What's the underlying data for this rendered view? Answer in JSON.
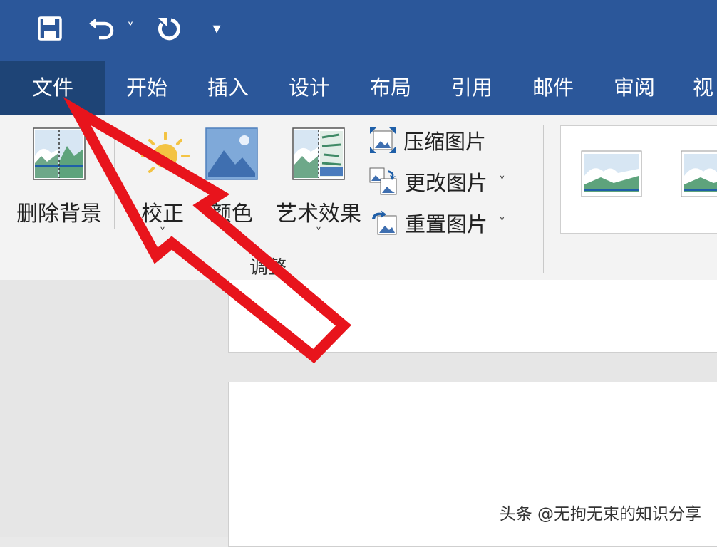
{
  "quick_access": {
    "save_icon": "save-icon",
    "undo_icon": "undo-icon",
    "undo_dropdown": "˅",
    "redo_icon": "redo-icon",
    "customize": "▾"
  },
  "tabs": [
    {
      "label": "文件",
      "active": true
    },
    {
      "label": "开始"
    },
    {
      "label": "插入"
    },
    {
      "label": "设计"
    },
    {
      "label": "布局"
    },
    {
      "label": "引用"
    },
    {
      "label": "邮件"
    },
    {
      "label": "审阅"
    },
    {
      "label": "视"
    }
  ],
  "ribbon": {
    "remove_background": "删除背景",
    "corrections": "校正",
    "color": "颜色",
    "artistic_effects": "艺术效果",
    "caret": "˅",
    "compress_pictures": "压缩图片",
    "change_picture": "更改图片",
    "reset_picture": "重置图片",
    "group_adjust": "调整"
  },
  "watermark": "头条 @无拘无束的知识分享",
  "colors": {
    "titlebar": "#2b579a",
    "active_tab": "#1e4476",
    "annotation_arrow": "#e8141c"
  }
}
